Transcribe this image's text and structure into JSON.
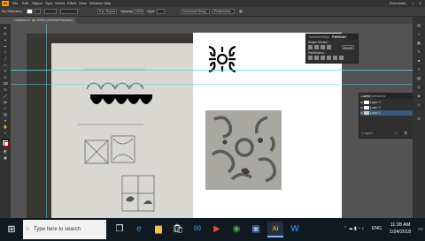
{
  "menubar": {
    "app_logo": "Ai",
    "items": [
      "File",
      "Edit",
      "Object",
      "Type",
      "Select",
      "Effect",
      "View",
      "Window",
      "Help"
    ],
    "workspace": "Essentials",
    "window_controls": [
      "minimize-icon",
      "maximize-icon",
      "close-icon"
    ]
  },
  "controlbar": {
    "selection": "No Selection",
    "stroke": "",
    "brush": "5 pt. Round",
    "opacity_label": "Opacity",
    "opacity": "100%",
    "style_label": "Style",
    "document_setup": "Document Setup",
    "preferences": "Preferences"
  },
  "document": {
    "tab_label": "Untitled-1* @ 125% (CMYK/Preview)"
  },
  "tools": [
    "selection-tool",
    "direct-selection-tool",
    "magic-wand-tool",
    "lasso-tool",
    "pen-tool",
    "curvature-tool",
    "type-tool",
    "line-tool",
    "rectangle-tool",
    "paintbrush-tool",
    "shaper-tool",
    "pencil-tool",
    "eraser-tool",
    "rotate-tool",
    "scale-tool",
    "width-tool",
    "free-transform-tool",
    "shape-builder-tool",
    "perspective-tool",
    "mesh-tool",
    "gradient-tool",
    "eyedropper-tool",
    "blend-tool",
    "symbol-sprayer-tool",
    "graph-tool",
    "artboard-tool",
    "slice-tool",
    "hand-tool",
    "zoom-tool"
  ],
  "pathfinder_panel": {
    "tabs": [
      "Transform",
      "Align",
      "Pathfinder"
    ],
    "active_tab": "Pathfinder",
    "shape_modes_label": "Shape Modes:",
    "expand_label": "Expand",
    "pathfinders_label": "Pathfinders:"
  },
  "layers_panel": {
    "tabs": [
      "Layers",
      "Artboards"
    ],
    "active_tab": "Layers",
    "layers": [
      {
        "name": "Layer 3"
      },
      {
        "name": "Layer 2"
      },
      {
        "name": "Layer 1"
      }
    ],
    "footer": "3 Layers"
  },
  "taskbar": {
    "search_placeholder": "Type here to search",
    "apps": [
      "task-view-icon",
      "edge-icon",
      "file-explorer-icon",
      "store-icon",
      "mail-icon",
      "media-icon",
      "chrome-icon",
      "photos-icon",
      "illustrator-icon",
      "word-icon"
    ],
    "active_app": "illustrator-icon",
    "language": "ENG",
    "time": "11:28 AM",
    "date": "1/24/2018"
  },
  "colors": {
    "accent": "#ff9a00",
    "ui_dark": "#323232",
    "canvas": "#535353",
    "guide": "#5fd3e6",
    "taskbar": "#101820"
  }
}
